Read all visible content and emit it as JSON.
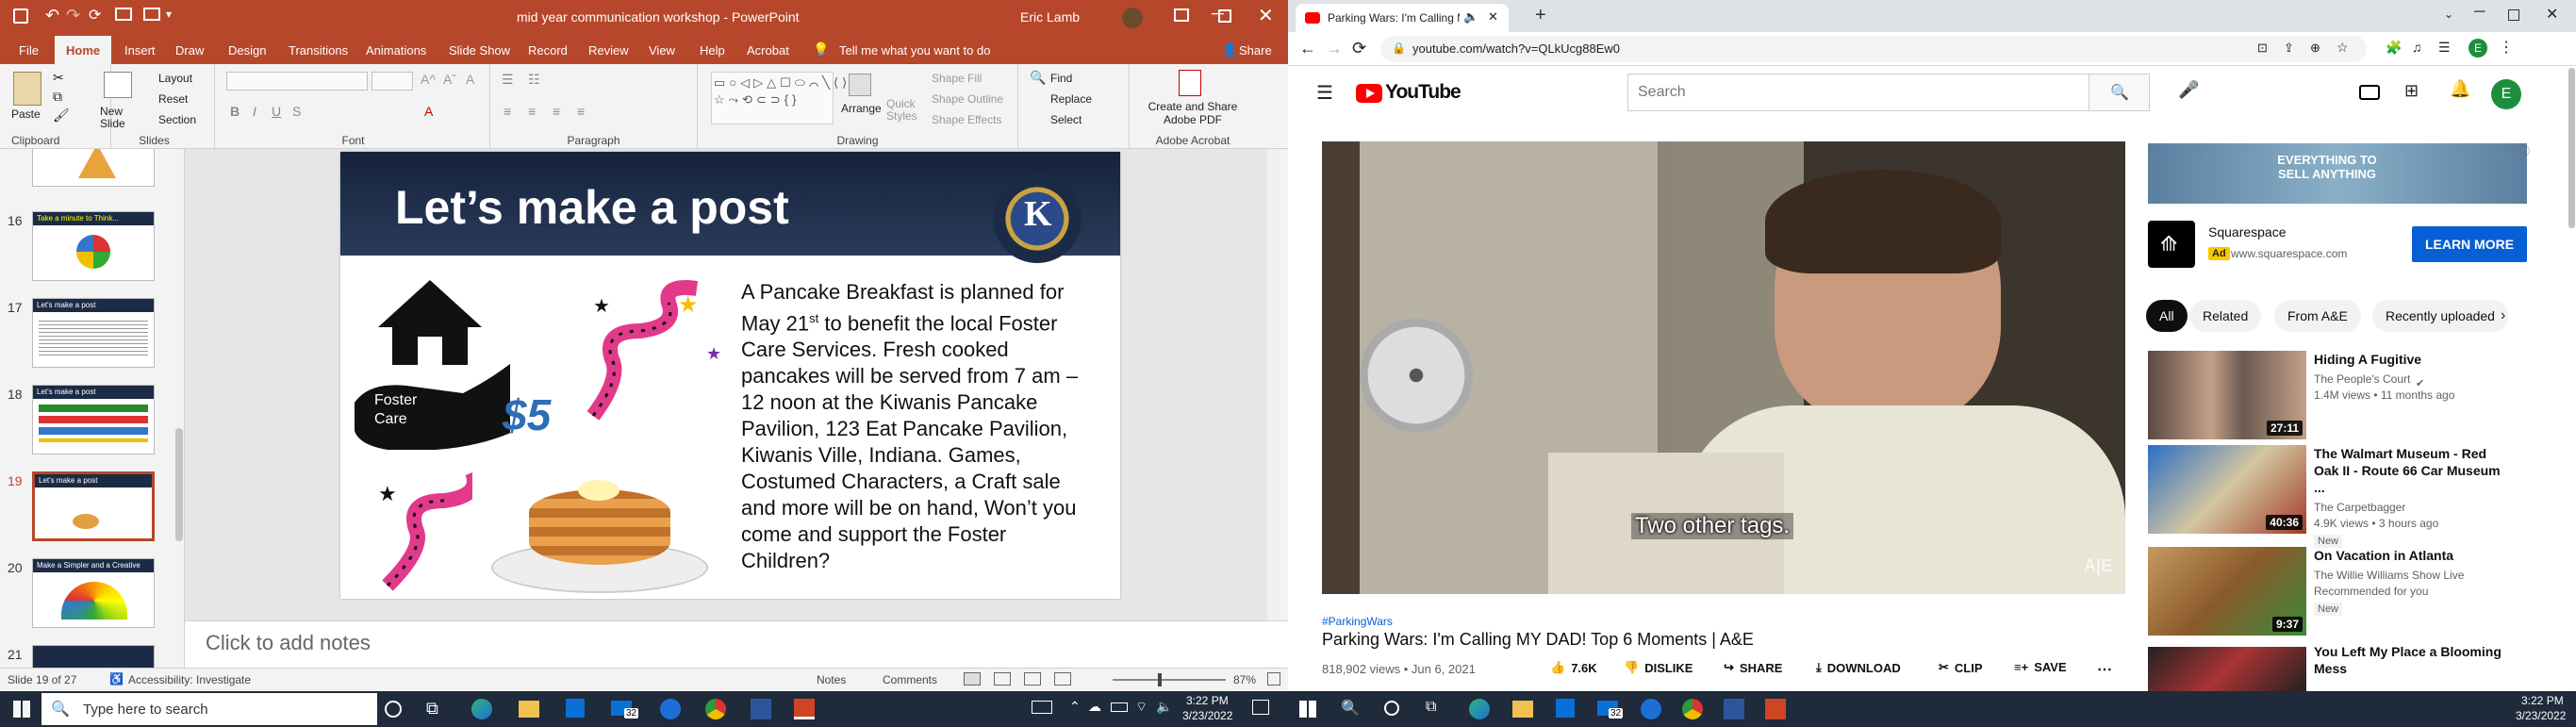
{
  "ppt": {
    "title": "mid year communication workshop  -  PowerPoint",
    "user": "Eric Lamb",
    "menu": [
      "File",
      "Home",
      "Insert",
      "Draw",
      "Design",
      "Transitions",
      "Animations",
      "Slide Show",
      "Record",
      "Review",
      "View",
      "Help",
      "Acrobat"
    ],
    "tell_me": "Tell me what you want to do",
    "share": "Share",
    "clipboard": {
      "paste": "Paste",
      "label": "Clipboard"
    },
    "slides_group": {
      "new_slide": "New Slide",
      "layout": "Layout",
      "reset": "Reset",
      "section": "Section",
      "label": "Slides"
    },
    "font_label": "Font",
    "paragraph_label": "Paragraph",
    "drawing": {
      "arrange": "Arrange",
      "quick_styles": "Quick Styles",
      "shape_fill": "Shape Fill",
      "shape_outline": "Shape Outline",
      "shape_effects": "Shape Effects",
      "label": "Drawing"
    },
    "editing": {
      "find": "Find",
      "replace": "Replace",
      "select": "Select"
    },
    "acrobat": {
      "create": "Create and Share Adobe PDF",
      "label": "Adobe Acrobat"
    },
    "thumb_numbers": [
      "16",
      "17",
      "18",
      "19",
      "20",
      "21"
    ],
    "thumb_titles": [
      "Take a minute to Think...",
      "Let's make a post",
      "Let's make a post",
      "Let's make a post",
      "Make a Simpler and a Creative",
      ""
    ],
    "slide": {
      "title": "Let’s make a post",
      "foster_care": "Foster Care",
      "price": "$5",
      "body_part1": "A Pancake Breakfast is planned for May 21",
      "body_sup": "st",
      "body_part2": " to benefit the local Foster Care Services.   Fresh cooked pancakes will be served from 7 am – 12 noon at the Kiwanis Pancake Pavilion, 123 Eat Pancake Pavilion, Kiwanis Ville, Indiana.   Games, Costumed Characters, a Craft sale and more will be on hand,  Won’t you come and support the Foster Children?",
      "logo_text": "KIWANIS INTERNATIONAL"
    },
    "notes_placeholder": "Click to add notes",
    "status": {
      "slide_of": "Slide 19 of 27",
      "accessibility": "Accessibility: Investigate",
      "notes": "Notes",
      "comments": "Comments",
      "zoom": "87%"
    }
  },
  "taskbar_left": {
    "search_placeholder": "Type here to search",
    "time": "3:22 PM",
    "date": "3/23/2022",
    "badge": "32"
  },
  "yt": {
    "tab_title": "Parking Wars: I'm Calling MY",
    "url": "youtube.com/watch?v=QLkUcg88Ew0",
    "logo_text": "YouTube",
    "search_placeholder": "Search",
    "avatar": "E",
    "caption": "Two other tags.",
    "hashtag": "#ParkingWars",
    "video_title": "Parking Wars: I'm Calling MY DAD! Top 6 Moments | A&E",
    "views_date": "818,902 views • Jun 6, 2021",
    "actions": {
      "likes": "7.6K",
      "dislike": "DISLIKE",
      "share": "SHARE",
      "download": "DOWNLOAD",
      "clip": "CLIP",
      "save": "SAVE"
    },
    "ad": {
      "banner": "EVERYTHING TO SELL ANYTHING",
      "name": "Squarespace",
      "badge": "Ad",
      "url": "www.squarespace.com",
      "cta": "LEARN MORE"
    },
    "chips": [
      "All",
      "Related",
      "From A&E",
      "Recently uploaded"
    ],
    "recs": [
      {
        "title": "Hiding A Fugitive",
        "channel": "The People's Court",
        "meta": "1.4M views • 11 months ago",
        "badge": "",
        "duration": "27:11"
      },
      {
        "title": "The Walmart Museum - Red Oak II - Route 66 Car Museum ...",
        "channel": "The Carpetbagger",
        "meta": "4.9K views • 3 hours ago",
        "badge": "New",
        "duration": "40:36"
      },
      {
        "title": "On Vacation in Atlanta",
        "channel": "The Willie Williams Show Live",
        "meta": "Recommended for you",
        "badge": "New",
        "duration": "9:37"
      },
      {
        "title": "You Left My Place a Blooming Mess",
        "channel": "",
        "meta": "",
        "badge": "",
        "duration": ""
      }
    ]
  },
  "taskbar_right": {
    "time": "3:22 PM",
    "date": "3/23/2022",
    "badge": "32"
  },
  "colors": {
    "ppt_red": "#b7472a",
    "yt_red": "#ff0000",
    "slide_navy": "#1c2b45",
    "blue_btn": "#065fd4"
  }
}
